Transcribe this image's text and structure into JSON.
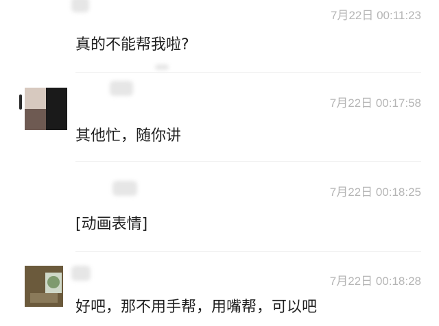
{
  "messages": [
    {
      "time": "7月22日 00:11:23",
      "text": "真的不能帮我啦?"
    },
    {
      "time": "7月22日 00:17:58",
      "text": "其他忙，随你讲"
    },
    {
      "time": "7月22日 00:18:25",
      "text": "[动画表情]"
    },
    {
      "time": "7月22日 00:18:28",
      "text": "好吧，那不用手帮，用嘴帮，可以吧"
    }
  ],
  "colors": {
    "timestamp": "#b5b5b5",
    "message_text": "#1f1f1f",
    "divider": "#efefef",
    "background": "#ffffff"
  }
}
